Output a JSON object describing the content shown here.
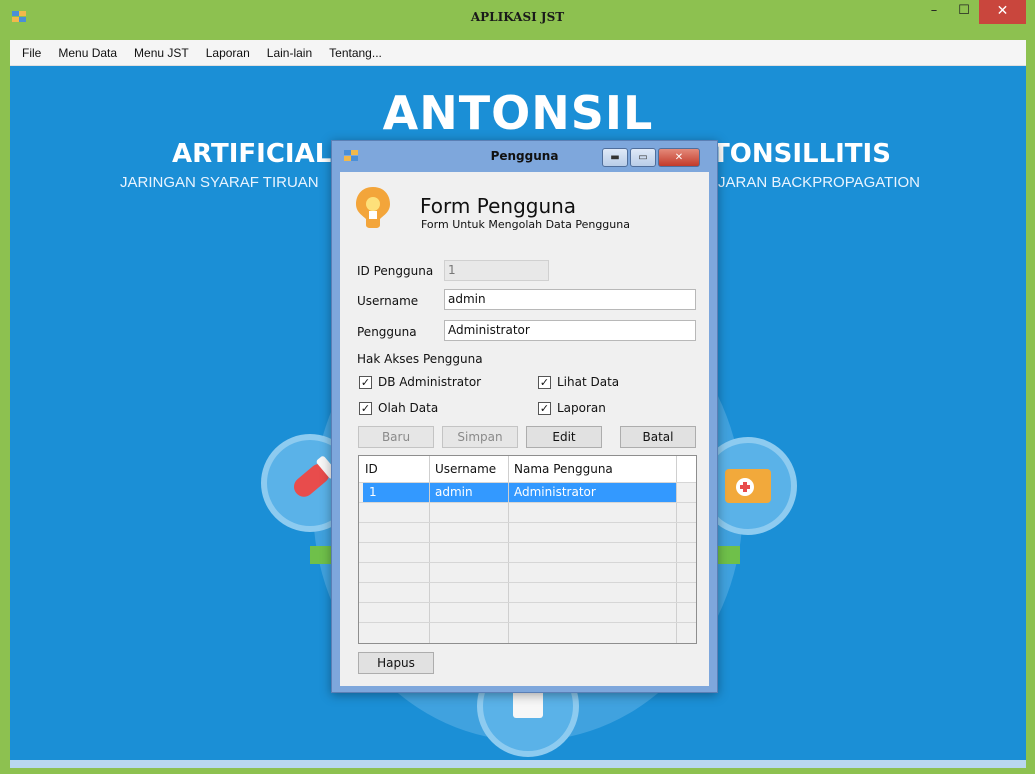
{
  "window": {
    "title": "APLIKASI JST",
    "minimize_glyph": "–",
    "maximize_glyph": "☐",
    "close_glyph": "✕"
  },
  "menu": {
    "items": [
      "File",
      "Menu Data",
      "Menu JST",
      "Laporan",
      "Lain-lain",
      "Tentang..."
    ]
  },
  "background": {
    "title": "ANTONSIL",
    "subtitle_left": "ARTIFICIAL",
    "subtitle_right": "TONSILLITIS",
    "tagline_left": "JARINGAN SYARAF TIRUAN",
    "tagline_right": "JARAN BACKPROPAGATION"
  },
  "dialog": {
    "title": "Pengguna",
    "heading": "Form Pengguna",
    "subheading": "Form Untuk Mengolah Data Pengguna",
    "fields": {
      "id_label": "ID Pengguna",
      "id_value": "1",
      "username_label": "Username",
      "username_value": "admin",
      "pengguna_label": "Pengguna",
      "pengguna_value": "Administrator"
    },
    "access": {
      "label": "Hak Akses Pengguna",
      "options": [
        {
          "label": "DB Administrator",
          "checked": true
        },
        {
          "label": "Lihat Data",
          "checked": true
        },
        {
          "label": "Olah Data",
          "checked": true
        },
        {
          "label": "Laporan",
          "checked": true
        }
      ]
    },
    "buttons": {
      "baru": "Baru",
      "simpan": "Simpan",
      "edit": "Edit",
      "batal": "Batal",
      "hapus": "Hapus"
    },
    "table": {
      "headers": [
        "ID",
        "Username",
        "Nama Pengguna"
      ],
      "rows": [
        [
          "1",
          "admin",
          "Administrator"
        ]
      ]
    }
  },
  "colors": {
    "titlebar": "#8dc150",
    "desktop_blue": "#1b8fd6",
    "selection": "#3399ff",
    "close_red": "#c9463d"
  }
}
